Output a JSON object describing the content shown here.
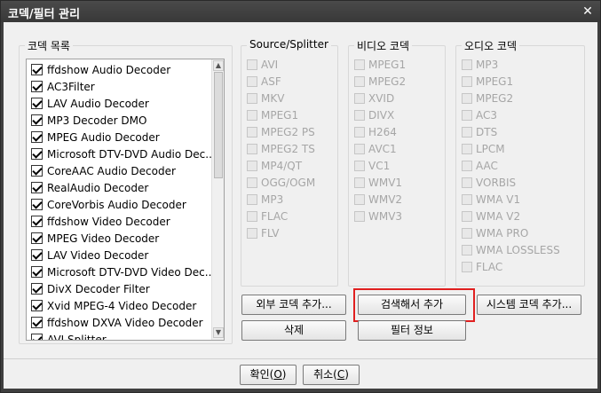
{
  "window": {
    "title": "코덱/필터 관리",
    "close_glyph": "✕"
  },
  "codec_group": {
    "title": "코덱 목록",
    "items": [
      {
        "label": "ffdshow Audio Decoder",
        "checked": true
      },
      {
        "label": "AC3Filter",
        "checked": true
      },
      {
        "label": "LAV Audio Decoder",
        "checked": true
      },
      {
        "label": "MP3 Decoder DMO",
        "checked": true
      },
      {
        "label": "MPEG Audio Decoder",
        "checked": true
      },
      {
        "label": "Microsoft DTV-DVD Audio Dec...",
        "checked": true
      },
      {
        "label": "CoreAAC Audio Decoder",
        "checked": true
      },
      {
        "label": "RealAudio Decoder",
        "checked": true
      },
      {
        "label": "CoreVorbis Audio Decoder",
        "checked": true
      },
      {
        "label": "ffdshow Video Decoder",
        "checked": true
      },
      {
        "label": "MPEG Video Decoder",
        "checked": true
      },
      {
        "label": "LAV Video Decoder",
        "checked": true
      },
      {
        "label": "Microsoft DTV-DVD Video Dec...",
        "checked": true
      },
      {
        "label": "DivX Decoder Filter",
        "checked": true
      },
      {
        "label": "Xvid MPEG-4 Video Decoder",
        "checked": true
      },
      {
        "label": "ffdshow DXVA Video Decoder",
        "checked": true
      },
      {
        "label": "AVI Splitter",
        "checked": true
      }
    ]
  },
  "source_group": {
    "title": "Source/Splitter",
    "items": [
      "AVI",
      "ASF",
      "MKV",
      "MPEG1",
      "MPEG2 PS",
      "MPEG2 TS",
      "MP4/QT",
      "OGG/OGM",
      "MP3",
      "FLAC",
      "FLV"
    ]
  },
  "video_group": {
    "title": "비디오 코덱",
    "items": [
      "MPEG1",
      "MPEG2",
      "XVID",
      "DIVX",
      "H264",
      "AVC1",
      "VC1",
      "WMV1",
      "WMV2",
      "WMV3"
    ]
  },
  "audio_group": {
    "title": "오디오 코덱",
    "items": [
      "MP3",
      "MPEG1",
      "MPEG2",
      "AC3",
      "DTS",
      "LPCM",
      "AAC",
      "VORBIS",
      "WMA V1",
      "WMA V2",
      "WMA PRO",
      "WMA LOSSLESS",
      "FLAC"
    ]
  },
  "buttons": {
    "external_add": "외부 코덱 추가...",
    "search_add": "검색해서 추가",
    "system_add": "시스템 코덱 추가...",
    "delete": "삭제",
    "filter_info": "필터 정보",
    "ok_prefix": "확인(",
    "ok_key": "O",
    "ok_suffix": ")",
    "cancel_prefix": "취소(",
    "cancel_key": "C",
    "cancel_suffix": ")"
  },
  "colors": {
    "highlight": "#e02020",
    "titlebar": "#3f3f3f"
  }
}
